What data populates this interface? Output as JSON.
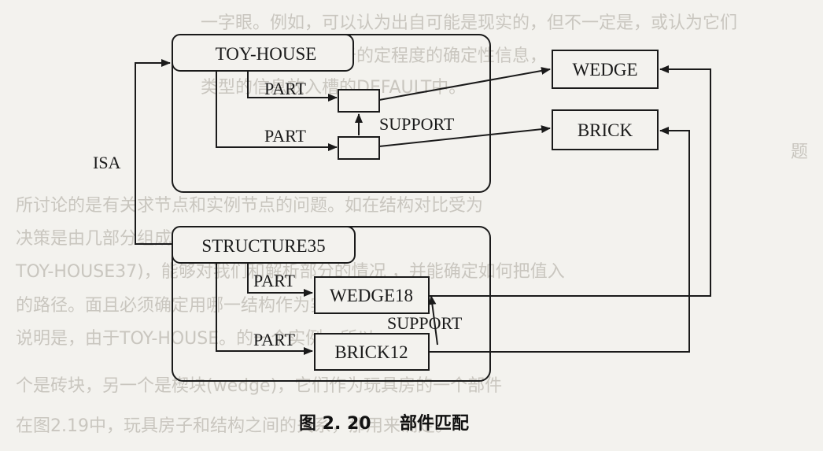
{
  "figure": {
    "caption_number": "图 2. 20",
    "caption_title": "部件匹配"
  },
  "model": {
    "head": "TOY-HOUSE",
    "part_label_1": "PART",
    "part_label_2": "PART",
    "support_label": "SUPPORT",
    "target_wedge": "WEDGE",
    "target_brick": "BRICK"
  },
  "instance": {
    "head": "STRUCTURE35",
    "part_label_1": "PART",
    "part_label_2": "PART",
    "support_label": "SUPPORT",
    "wedge": "WEDGE18",
    "brick": "BRICK12"
  },
  "isa_label": "ISA",
  "background_text": [
    "一字眼。例如，可以认为出自可能是现实的，但不一定是，或认为它们",
    "一定是。把每种关于的定程度的确定性信息，",
    "类型的信息放入槽的DEFAULT中。",
    "题",
    "所讨论的是有关求节点和实例节点的问题。如在结构对比受为",
    "决策是由几部分组成的举例时，如图。",
    "TOY-HOUSE37)，能够对我们和解析部分的情况 ，并能确定如何把值入",
    "的路径。面且必须确定用哪一结构作为实例。",
    "说明是，由于TOY-HOUSE。的一个实例，所以",
    "个是砖块，另一个是楔块(wedge)，它们作为玩具房的一个部件",
    "在图2.19中，玩具房子和结构之间的关系，那用来确定。"
  ]
}
